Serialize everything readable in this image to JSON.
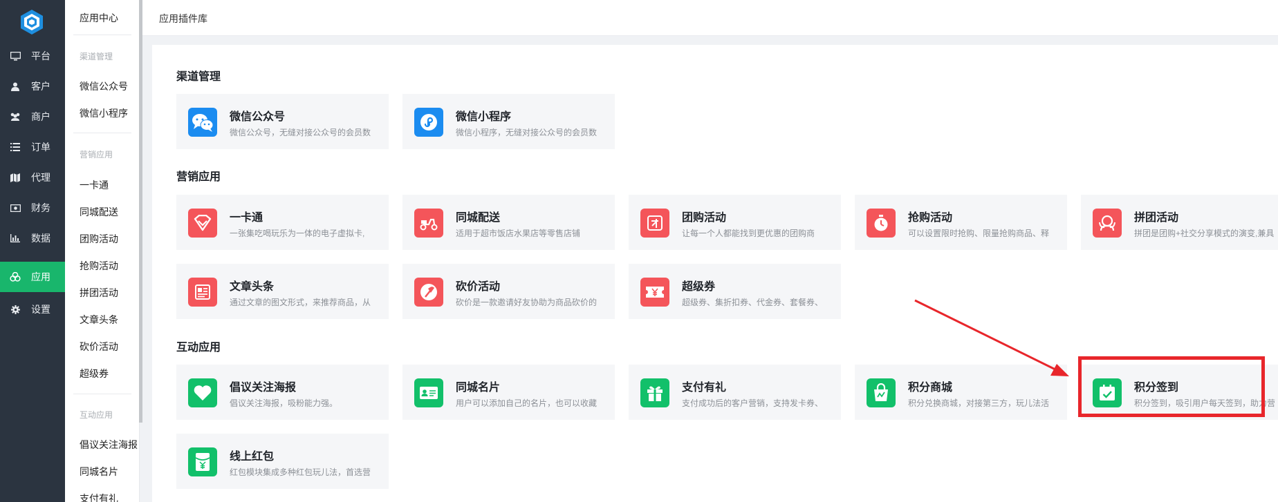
{
  "nav": {
    "items": [
      {
        "label": "平台",
        "icon": "monitor-icon"
      },
      {
        "label": "客户",
        "icon": "user-icon"
      },
      {
        "label": "商户",
        "icon": "users-icon"
      },
      {
        "label": "订单",
        "icon": "list-icon"
      },
      {
        "label": "代理",
        "icon": "map-icon"
      },
      {
        "label": "财务",
        "icon": "money-icon"
      },
      {
        "label": "数据",
        "icon": "bar-chart-icon"
      },
      {
        "label": "应用",
        "icon": "cubes-icon",
        "active": true
      },
      {
        "label": "设置",
        "icon": "gear-icon"
      }
    ]
  },
  "sub": {
    "header": "应用中心",
    "channel_section": "渠道管理",
    "channel_items": [
      "微信公众号",
      "微信小程序"
    ],
    "marketing_section": "营销应用",
    "marketing_items": [
      "一卡通",
      "同城配送",
      "团购活动",
      "抢购活动",
      "拼团活动",
      "文章头条",
      "砍价活动",
      "超级券"
    ],
    "interact_section": "互动应用",
    "interact_items": [
      "倡议关注海报",
      "同城名片",
      "支付有礼"
    ]
  },
  "header": {
    "title": "应用插件库"
  },
  "sections": {
    "channel": {
      "title": "渠道管理",
      "cards": [
        {
          "name": "微信公众号",
          "desc": "微信公众号，无缝对接公众号的会员数",
          "icon": "wechat-icon",
          "color": "#1b8cf0"
        },
        {
          "name": "微信小程序",
          "desc": "微信小程序，无缝对接公众号的会员数",
          "icon": "mini-program-icon",
          "color": "#1b8cf0"
        }
      ]
    },
    "marketing": {
      "title": "营销应用",
      "cards": [
        {
          "name": "一卡通",
          "desc": "一张集吃喝玩乐为一体的电子虚拟卡,",
          "icon": "diamond-card-icon",
          "color": "#f4555a"
        },
        {
          "name": "同城配送",
          "desc": "适用于超市饭店水果店等零售店铺",
          "icon": "scooter-icon",
          "color": "#f4555a"
        },
        {
          "name": "团购活动",
          "desc": "让每一个人都能找到更优惠的团购商",
          "icon": "group-buy-icon",
          "color": "#f4555a"
        },
        {
          "name": "抢购活动",
          "desc": "可以设置限时抢购、限量抢购商品、释",
          "icon": "stopwatch-icon",
          "color": "#f4555a"
        },
        {
          "name": "拼团活动",
          "desc": "拼团是团购+社交分享模式的演变,兼具",
          "icon": "group-icon",
          "color": "#f4555a"
        },
        {
          "name": "文章头条",
          "desc": "通过文章的图文形式，来推荐商品，从",
          "icon": "article-icon",
          "color": "#f4555a"
        },
        {
          "name": "砍价活动",
          "desc": "砍价是一款邀请好友协助为商品砍价的",
          "icon": "axe-icon",
          "color": "#f4555a"
        },
        {
          "name": "超级券",
          "desc": "超级券、集折扣券、代金券、套餐券、",
          "icon": "coupon-icon",
          "color": "#f4555a"
        }
      ]
    },
    "interact": {
      "title": "互动应用",
      "cards": [
        {
          "name": "倡议关注海报",
          "desc": "倡议关注海报，吸粉能力强。",
          "icon": "heart-icon",
          "color": "#12c06a"
        },
        {
          "name": "同城名片",
          "desc": "用户可以添加自己的名片，也可以收藏",
          "icon": "business-card-icon",
          "color": "#12c06a"
        },
        {
          "name": "支付有礼",
          "desc": "支付成功后的客户营销，支持发卡券、",
          "icon": "gift-icon",
          "color": "#12c06a"
        },
        {
          "name": "积分商城",
          "desc": "积分兑换商城，对接第三方，玩儿法活",
          "icon": "shopping-bag-icon",
          "color": "#12c06a"
        },
        {
          "name": "积分签到",
          "desc": "积分签到，吸引用户每天签到，助力营",
          "icon": "calendar-check-icon",
          "color": "#12c06a"
        },
        {
          "name": "线上红包",
          "desc": "红包模块集成多种红包玩儿法，首选营",
          "icon": "red-envelope-icon",
          "color": "#12c06a"
        }
      ]
    }
  }
}
